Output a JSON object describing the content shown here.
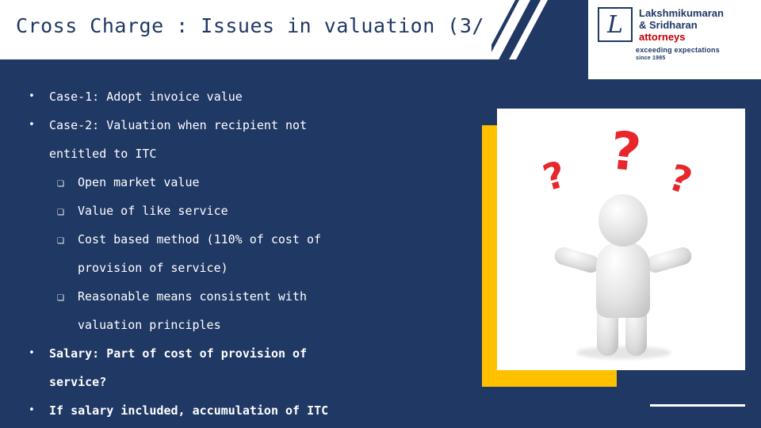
{
  "slide": {
    "title": "Cross Charge :  Issues in valuation (3/",
    "background_color": "#1F3864",
    "accent_color": "#FFC000"
  },
  "logo": {
    "monogram": "L",
    "line1": "Lakshmikumaran",
    "line2": "& Sridharan",
    "line3": "attorneys",
    "tagline": "exceeding expectations",
    "since": "since 1985",
    "brand_color": "#1F3864",
    "accent_color": "#C00000"
  },
  "bullets": [
    {
      "level": 1,
      "marker": "•",
      "text": "Case-1: Adopt invoice value",
      "bold": false
    },
    {
      "level": 1,
      "marker": "•",
      "text": "Case-2: Valuation when recipient not",
      "bold": false
    },
    {
      "level": "cont1",
      "marker": "",
      "text": "entitled to ITC",
      "bold": false
    },
    {
      "level": 2,
      "marker": "❏",
      "text": "Open market value",
      "bold": false
    },
    {
      "level": 2,
      "marker": "❏",
      "text": "Value of like service",
      "bold": false
    },
    {
      "level": 2,
      "marker": "❏",
      "text": "Cost based method (110% of cost of",
      "bold": false
    },
    {
      "level": "cont2",
      "marker": "",
      "text": "provision of service)",
      "bold": false
    },
    {
      "level": 2,
      "marker": "❏",
      "text": "Reasonable means consistent with",
      "bold": false
    },
    {
      "level": "cont2",
      "marker": "",
      "text": "valuation principles",
      "bold": false
    },
    {
      "level": 1,
      "marker": "•",
      "text": "Salary: Part of cost of provision of",
      "bold": true
    },
    {
      "level": "cont1",
      "marker": "",
      "text": "service?",
      "bold": true
    },
    {
      "level": 1,
      "marker": "•",
      "text": "If salary included, accumulation of ITC",
      "bold": true
    }
  ],
  "image": {
    "alt": "confused-person-with-question-marks",
    "question_mark": "?"
  }
}
